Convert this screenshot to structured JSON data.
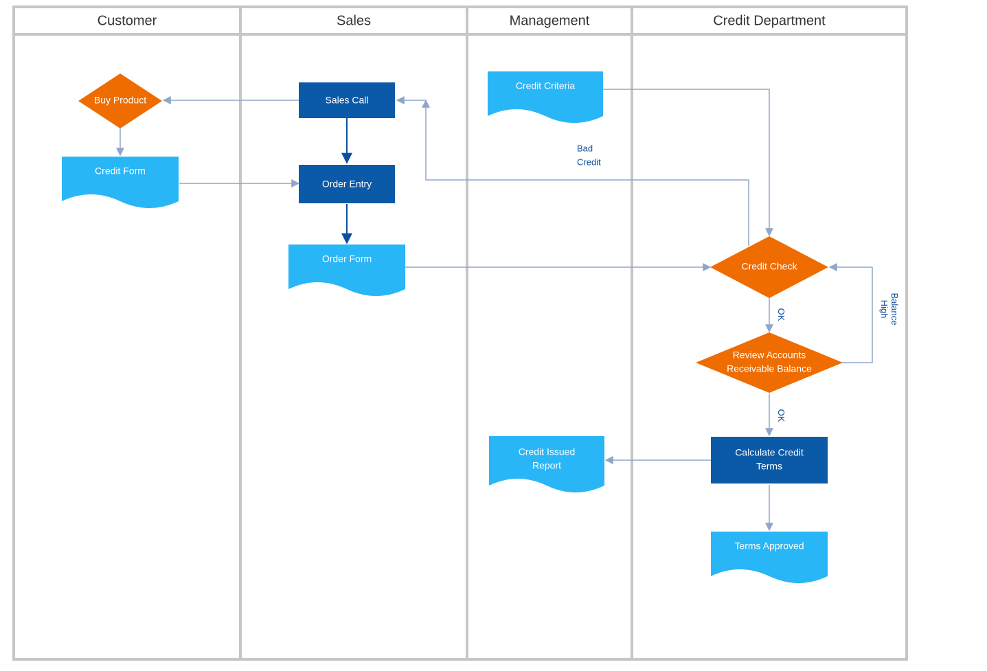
{
  "lanes": {
    "customer": "Customer",
    "sales": "Sales",
    "management": "Management",
    "credit": "Credit Department"
  },
  "nodes": {
    "buy_product": "Buy Product",
    "credit_form": "Credit Form",
    "sales_call": "Sales Call",
    "order_entry": "Order Entry",
    "order_form": "Order Form",
    "credit_criteria": "Credit Criteria",
    "credit_check": "Credit Check",
    "review_accounts_l1": "Review Accounts",
    "review_accounts_l2": "Receivable Balance",
    "calc_credit_l1": "Calculate Credit",
    "calc_credit_l2": "Terms",
    "credit_issued_l1": "Credit Issued",
    "credit_issued_l2": "Report",
    "terms_approved": "Terms Approved"
  },
  "edge_labels": {
    "bad_credit_l1": "Bad",
    "bad_credit_l2": "Credit",
    "ok1": "OK",
    "ok2": "OK",
    "high_balance_l1": "High",
    "high_balance_l2": "Balance"
  },
  "colors": {
    "lane_border": "#c6c6c6",
    "orange": "#ef6c00",
    "blue_dark": "#0b5aa8",
    "blue_light": "#29b6f6",
    "arrow": "#8fa6c9",
    "arrow_dark": "#0b4f9e"
  }
}
